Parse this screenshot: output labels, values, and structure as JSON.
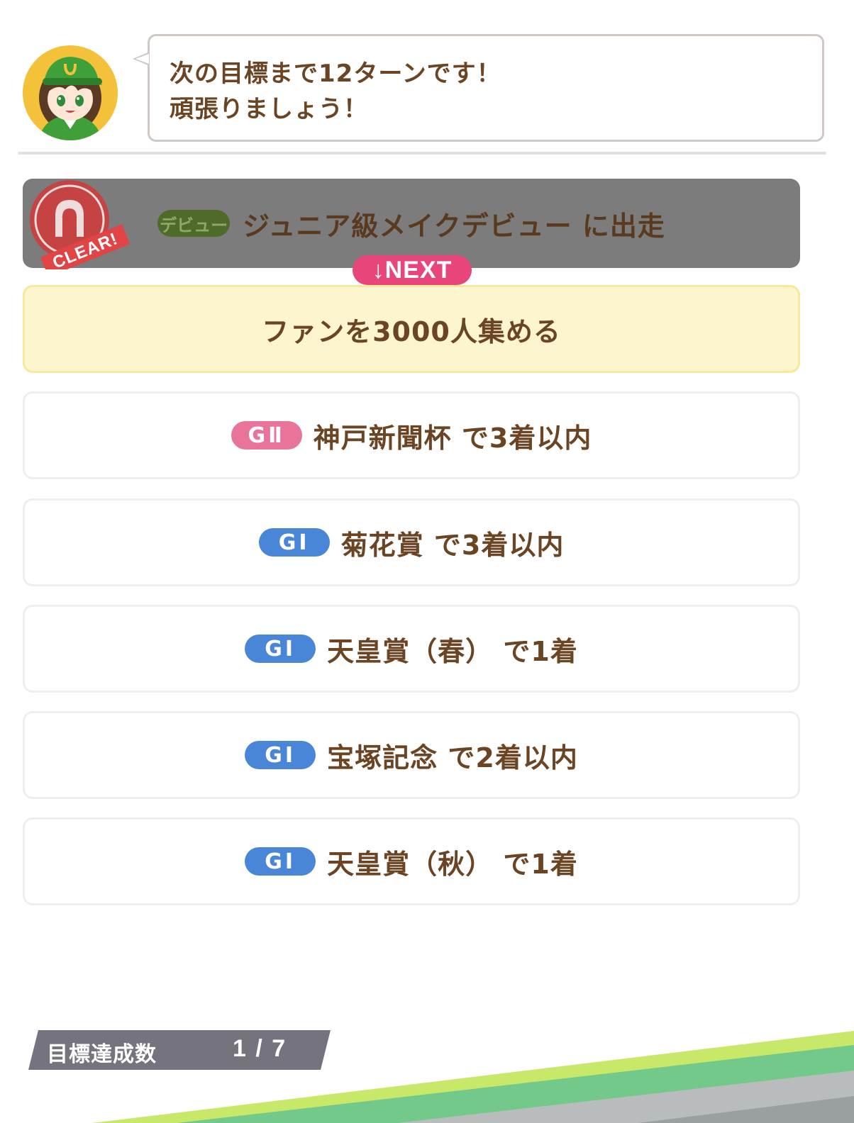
{
  "speech": {
    "line1": "次の目標まで12ターンです！",
    "line2": "頑張りましょう！"
  },
  "goals": [
    {
      "status": "cleared",
      "grade": "デビュー",
      "text": "ジュニア級メイクデビュー に出走"
    },
    {
      "status": "current",
      "grade": "",
      "text": "ファンを3000人集める"
    },
    {
      "status": "pending",
      "grade": "GⅡ",
      "text": "神戸新聞杯 で3着以内"
    },
    {
      "status": "pending",
      "grade": "GⅠ",
      "text": "菊花賞 で3着以内"
    },
    {
      "status": "pending",
      "grade": "GⅠ",
      "text": "天皇賞（春） で1着"
    },
    {
      "status": "pending",
      "grade": "GⅠ",
      "text": "宝塚記念 で2着以内"
    },
    {
      "status": "pending",
      "grade": "GⅠ",
      "text": "天皇賞（秋） で1着"
    }
  ],
  "clear_stamp": "CLEAR!",
  "next_badge": "↓NEXT",
  "progress": {
    "label": "目標達成数",
    "value": "1 / 7",
    "achieved": 1,
    "total": 7
  },
  "colors": {
    "text_brown": "#6b4423",
    "next_pink": "#e8457a",
    "grade1_blue": "#4a86d8",
    "grade2_pink": "#e8749a",
    "debut_green": "#4e6b2a",
    "current_yellow": "#fdf5cd",
    "cleared_gray": "#7c7c7c",
    "stamp_red": "#d94848"
  },
  "icons": {
    "avatar": "trainer-avatar-icon",
    "clear": "clear-stamp-icon",
    "next": "down-arrow-icon"
  }
}
